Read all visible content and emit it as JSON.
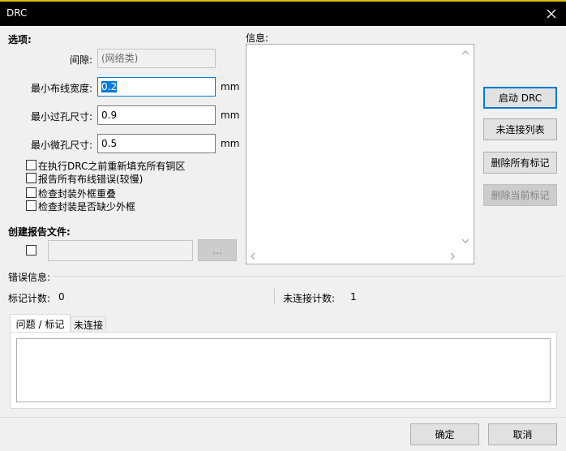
{
  "window": {
    "title": "DRC",
    "close_glyph": "✕"
  },
  "options": {
    "heading": "选项:",
    "clearance_label": "间隙:",
    "clearance_value": "(网络类)",
    "min_track_label": "最小布线宽度:",
    "min_track_value": "0.2",
    "min_via_label": "最小过孔尺寸:",
    "min_via_value": "0.9",
    "min_uvia_label": "最小微孔尺寸:",
    "min_uvia_value": "0.5",
    "unit": "mm",
    "checkboxes": [
      "在执行DRC之前重新填充所有铜区",
      "报告所有布线错误(较慢)",
      "检查封装外框重叠",
      "检查封装是否缺少外框"
    ]
  },
  "report": {
    "heading": "创建报告文件:",
    "path_value": "",
    "browse_label": "..."
  },
  "info": {
    "heading": "信息:"
  },
  "actions": {
    "start": "启动 DRC",
    "unconnected_list": "未连接列表",
    "delete_all": "删除所有标记",
    "delete_current": "删除当前标记"
  },
  "errors": {
    "heading": "错误信息:",
    "marker_count_label": "标记计数:",
    "marker_count_value": "0",
    "unconnected_count_label": "未连接计数:",
    "unconnected_count_value": "1",
    "tabs": [
      "问题 / 标记",
      "未连接"
    ]
  },
  "footer": {
    "ok": "确定",
    "cancel": "取消"
  },
  "icons": {
    "scroll_up": "scroll-up-icon",
    "scroll_down": "scroll-down-icon",
    "scroll_left": "scroll-left-icon",
    "scroll_right": "scroll-right-icon"
  }
}
